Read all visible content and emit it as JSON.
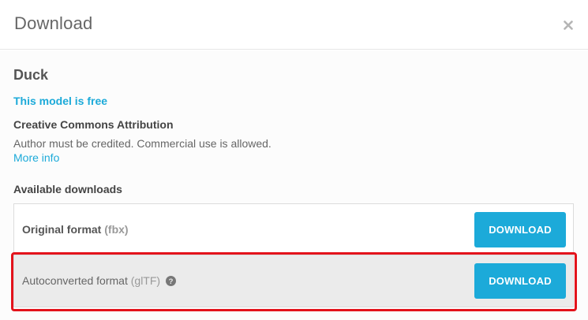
{
  "header": {
    "title": "Download",
    "close_icon": "close-icon"
  },
  "model": {
    "name": "Duck",
    "price_label": "This model is free"
  },
  "license": {
    "title": "Creative Commons Attribution",
    "description": "Author must be credited. Commercial use is allowed.",
    "more_info_label": "More info"
  },
  "downloads": {
    "section_title": "Available downloads",
    "items": [
      {
        "name": "Original format",
        "ext": "(fbx)",
        "button_label": "DOWNLOAD",
        "has_help": false
      },
      {
        "name": "Autoconverted format",
        "ext": "(glTF)",
        "button_label": "DOWNLOAD",
        "has_help": true,
        "help_icon": "question-circle-icon"
      }
    ]
  },
  "colors": {
    "accent": "#1caad9",
    "highlight": "#e3131b"
  }
}
